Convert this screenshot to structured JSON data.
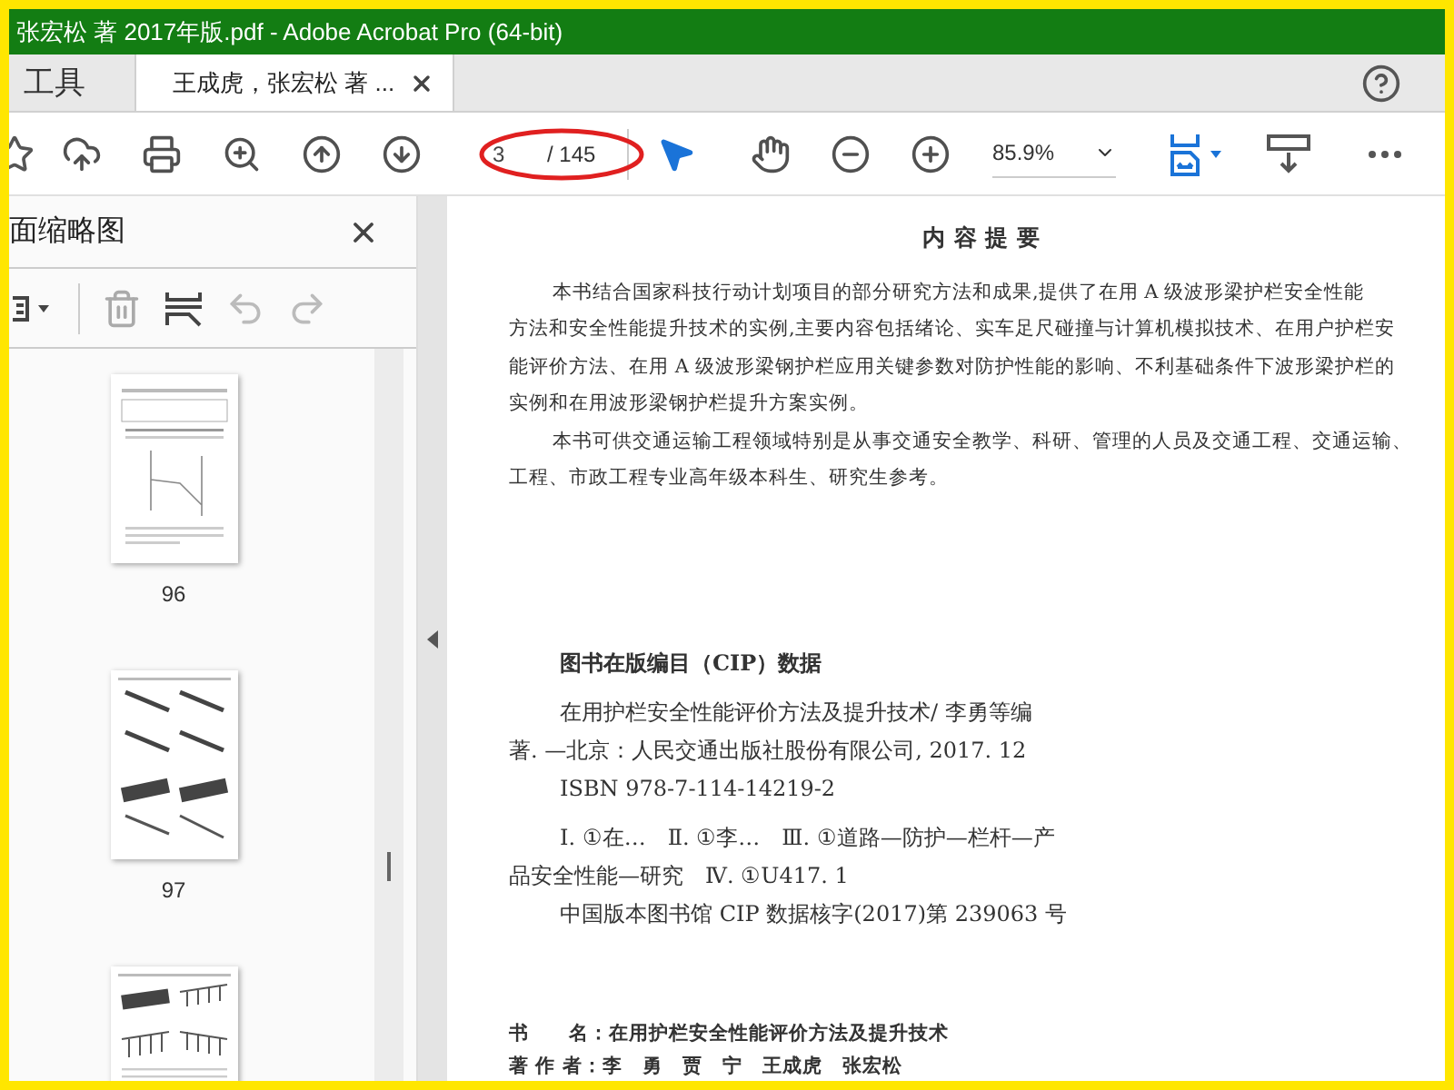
{
  "window": {
    "title": "张宏松 著 2017年版.pdf - Adobe Acrobat Pro (64-bit)"
  },
  "tabs": [
    {
      "label": "工具",
      "selected": false,
      "closable": false
    },
    {
      "label": "王成虎，张宏松 著 ...",
      "selected": true,
      "closable": true
    }
  ],
  "toolbar": {
    "page_number": "3",
    "page_total": "/ 145",
    "zoom": "85.9%"
  },
  "sidebar": {
    "title": "面缩略图",
    "thumbnails": [
      {
        "kind": "table",
        "label": "96"
      },
      {
        "kind": "beams",
        "label": "97"
      },
      {
        "kind": "posts"
      }
    ]
  },
  "document": {
    "heading": "内 容 提 要",
    "abstract": [
      {
        "text": "本书结合国家科技行动计划项目的部分研究方法和成果,提供了在用 A 级波形梁护栏安全性能",
        "indent": true
      },
      {
        "text": "方法和安全性能提升技术的实例,主要内容包括绪论、实车足尺碰撞与计算机模拟技术、在用户护栏安",
        "indent": false
      },
      {
        "text": "能评价方法、在用 A 级波形梁钢护栏应用关键参数对防护性能的影响、不利基础条件下波形梁护栏的",
        "indent": false
      },
      {
        "text": "实例和在用波形梁钢护栏提升方案实例。",
        "indent": false
      },
      {
        "text": "本书可供交通运输工程领域特别是从事交通安全教学、科研、管理的人员及交通工程、交通运输、",
        "indent": true
      },
      {
        "text": "工程、市政工程专业高年级本科生、研究生参考。",
        "indent": false
      }
    ],
    "cip_heading": "图书在版编目（CIP）数据",
    "cip_lines": [
      {
        "text": "在用护栏安全性能评价方法及提升技术/ 李勇等编",
        "indent": true
      },
      {
        "text": "著. —北京：人民交通出版社股份有限公司, 2017. 12",
        "indent": false
      },
      {
        "text": "ISBN 978-7-114-14219-2",
        "indent": true
      },
      {
        "text": "Ⅰ. ①在…　Ⅱ. ①李…　Ⅲ. ①道路—防护—栏杆—产",
        "indent": true
      },
      {
        "text": "品安全性能—研究　Ⅳ. ①U417. 1",
        "indent": false
      },
      {
        "text": "中国版本图书馆 CIP 数据核字(2017)第 239063 号",
        "indent": true
      }
    ],
    "details": [
      {
        "label": "书　　名：",
        "value": "在用护栏安全性能评价方法及提升技术"
      },
      {
        "label": "著 作 者：",
        "value": "李　勇　贾　宁　王成虎　张宏松"
      }
    ]
  }
}
